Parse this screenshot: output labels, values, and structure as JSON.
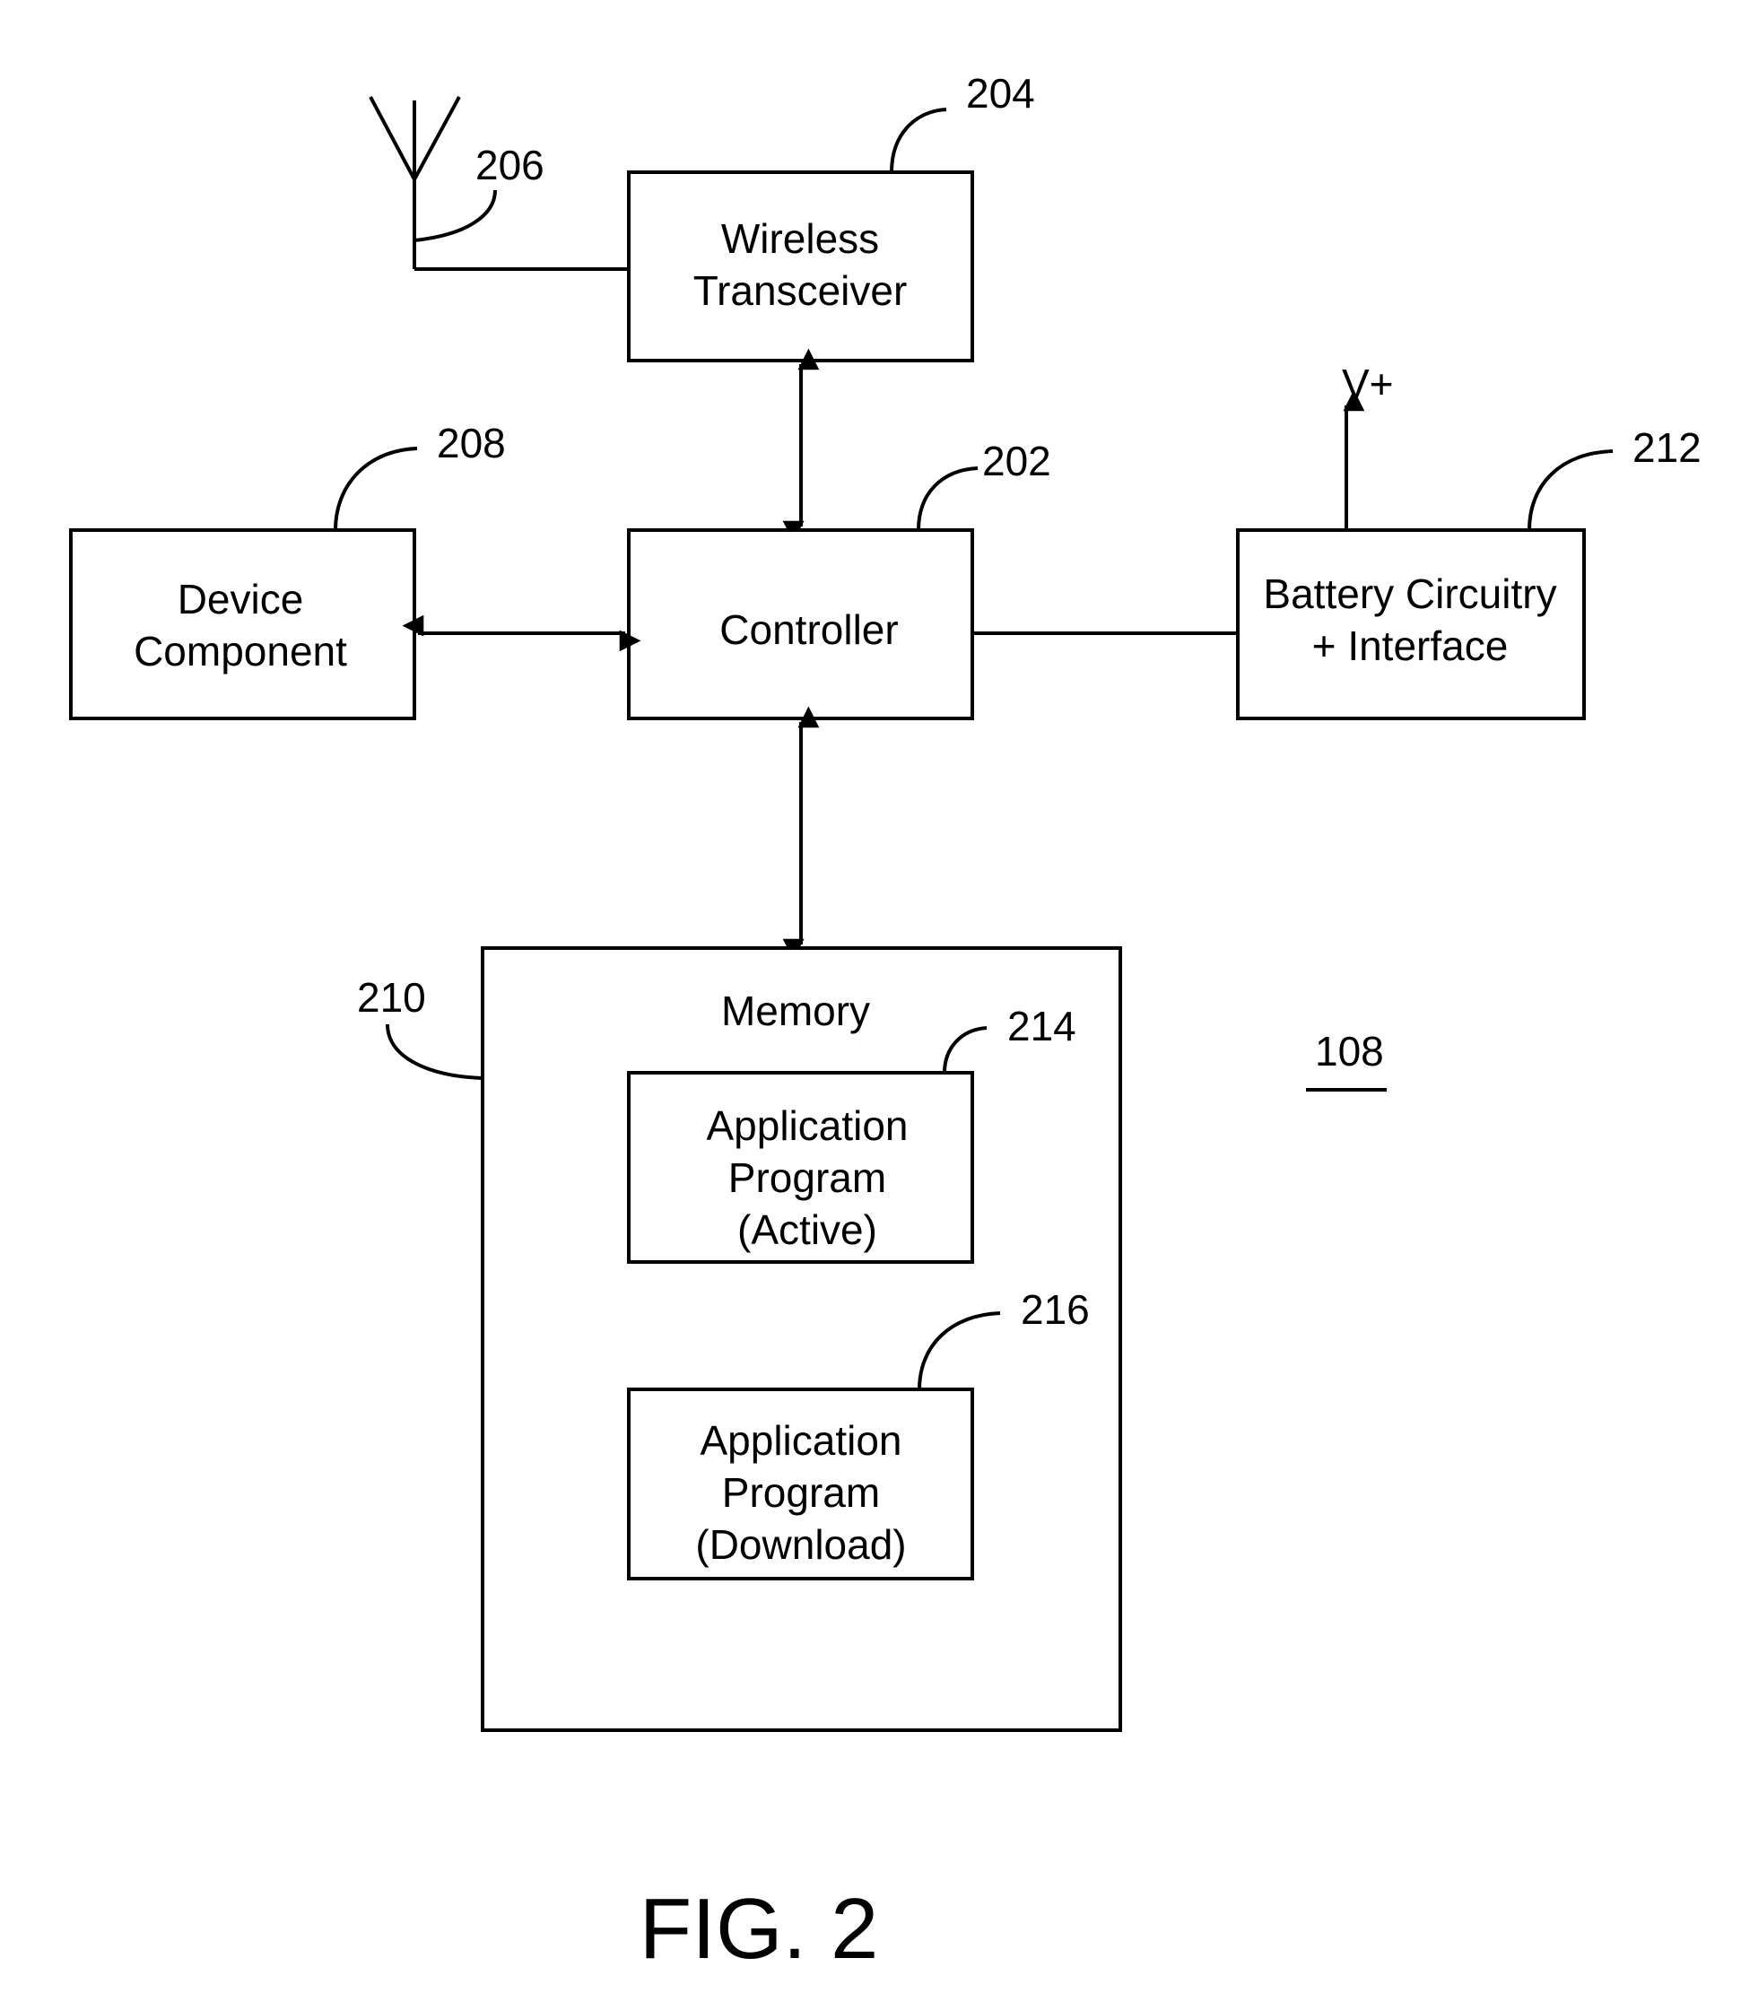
{
  "figure": {
    "caption": "FIG. 2",
    "device_ref": "108"
  },
  "blocks": {
    "wireless_transceiver": {
      "ref": "204",
      "lines": [
        "Wireless",
        "Transceiver"
      ]
    },
    "controller": {
      "ref": "202",
      "lines": [
        "Controller"
      ]
    },
    "device_component": {
      "ref": "208",
      "lines": [
        "Device",
        "Component"
      ]
    },
    "battery": {
      "ref": "212",
      "lines": [
        "Battery Circuitry",
        "+ Interface"
      ],
      "output_label": "V+"
    },
    "memory": {
      "ref": "210",
      "title": "Memory"
    },
    "app_active": {
      "ref": "214",
      "lines": [
        "Application",
        "Program",
        "(Active)"
      ]
    },
    "app_download": {
      "ref": "216",
      "lines": [
        "Application",
        "Program",
        "(Download)"
      ]
    },
    "antenna": {
      "ref": "206"
    }
  },
  "connections": [
    {
      "from": "antenna",
      "to": "wireless_transceiver",
      "type": "line"
    },
    {
      "from": "wireless_transceiver",
      "to": "controller",
      "type": "bidirectional-arrow"
    },
    {
      "from": "device_component",
      "to": "controller",
      "type": "bidirectional-arrow"
    },
    {
      "from": "controller",
      "to": "battery",
      "type": "line"
    },
    {
      "from": "battery",
      "to": "V+",
      "type": "arrow"
    },
    {
      "from": "controller",
      "to": "memory",
      "type": "bidirectional-arrow"
    }
  ]
}
